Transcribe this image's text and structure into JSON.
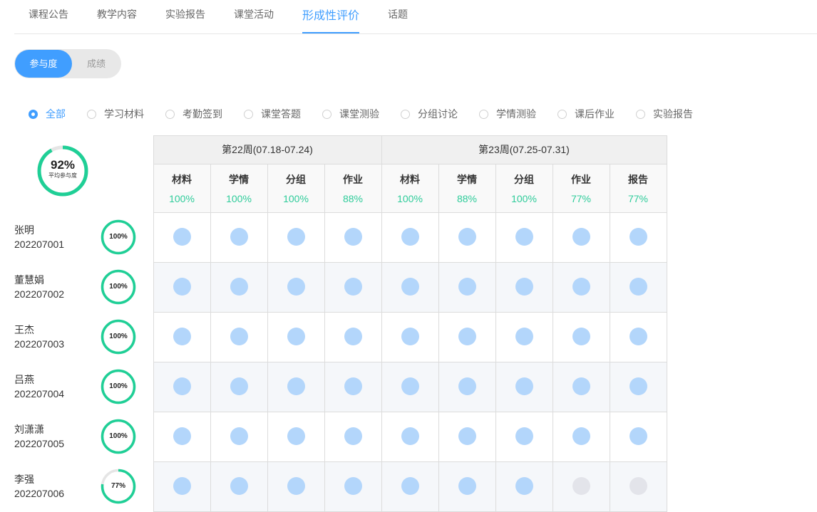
{
  "tabs": [
    {
      "label": "课程公告",
      "active": false
    },
    {
      "label": "教学内容",
      "active": false
    },
    {
      "label": "实验报告",
      "active": false
    },
    {
      "label": "课堂活动",
      "active": false
    },
    {
      "label": "形成性评价",
      "active": true
    },
    {
      "label": "话题",
      "active": false
    }
  ],
  "toggle": {
    "selected": "参与度",
    "other": "成绩"
  },
  "filters": [
    {
      "label": "全部",
      "selected": true
    },
    {
      "label": "学习材料",
      "selected": false
    },
    {
      "label": "考勤签到",
      "selected": false
    },
    {
      "label": "课堂答题",
      "selected": false
    },
    {
      "label": "课堂测验",
      "selected": false
    },
    {
      "label": "分组讨论",
      "selected": false
    },
    {
      "label": "学情测验",
      "selected": false
    },
    {
      "label": "课后作业",
      "selected": false
    },
    {
      "label": "实验报告",
      "selected": false
    }
  ],
  "average": {
    "percent": "92%",
    "value": 0.92,
    "label": "平均参与度"
  },
  "weeks": [
    {
      "label": "第22周(07.18-07.24)",
      "span": 4
    },
    {
      "label": "第23周(07.25-07.31)",
      "span": 5
    }
  ],
  "columns": [
    {
      "name": "材料",
      "pct": "100%"
    },
    {
      "name": "学情",
      "pct": "100%"
    },
    {
      "name": "分组",
      "pct": "100%"
    },
    {
      "name": "作业",
      "pct": "88%"
    },
    {
      "name": "材料",
      "pct": "100%"
    },
    {
      "name": "学情",
      "pct": "88%"
    },
    {
      "name": "分组",
      "pct": "100%"
    },
    {
      "name": "作业",
      "pct": "77%"
    },
    {
      "name": "报告",
      "pct": "77%"
    }
  ],
  "students": [
    {
      "name": "张明",
      "id": "202207001",
      "percent": "100%",
      "value": 1.0,
      "cells": [
        1,
        1,
        1,
        1,
        1,
        1,
        1,
        1,
        1
      ]
    },
    {
      "name": "董慧娟",
      "id": "202207002",
      "percent": "100%",
      "value": 1.0,
      "cells": [
        1,
        1,
        1,
        1,
        1,
        1,
        1,
        1,
        1
      ]
    },
    {
      "name": "王杰",
      "id": "202207003",
      "percent": "100%",
      "value": 1.0,
      "cells": [
        1,
        1,
        1,
        1,
        1,
        1,
        1,
        1,
        1
      ]
    },
    {
      "name": "吕燕",
      "id": "202207004",
      "percent": "100%",
      "value": 1.0,
      "cells": [
        1,
        1,
        1,
        1,
        1,
        1,
        1,
        1,
        1
      ]
    },
    {
      "name": "刘潇潇",
      "id": "202207005",
      "percent": "100%",
      "value": 1.0,
      "cells": [
        1,
        1,
        1,
        1,
        1,
        1,
        1,
        1,
        1
      ]
    },
    {
      "name": "李强",
      "id": "202207006",
      "percent": "77%",
      "value": 0.77,
      "cells": [
        1,
        1,
        1,
        1,
        1,
        1,
        1,
        0,
        0
      ]
    }
  ],
  "colors": {
    "accent": "#409eff",
    "ring": "#1fcf96",
    "ring_track": "#e5e5e5",
    "participated": "#b3d6fb",
    "missed": "#e3e4ea",
    "pct_text": "#2ecc9a",
    "header_bg": "#f0f0f0",
    "subheader_bg": "#f9f9f9",
    "stripe_bg": "#f5f7fa",
    "border": "#dcdcdc"
  }
}
